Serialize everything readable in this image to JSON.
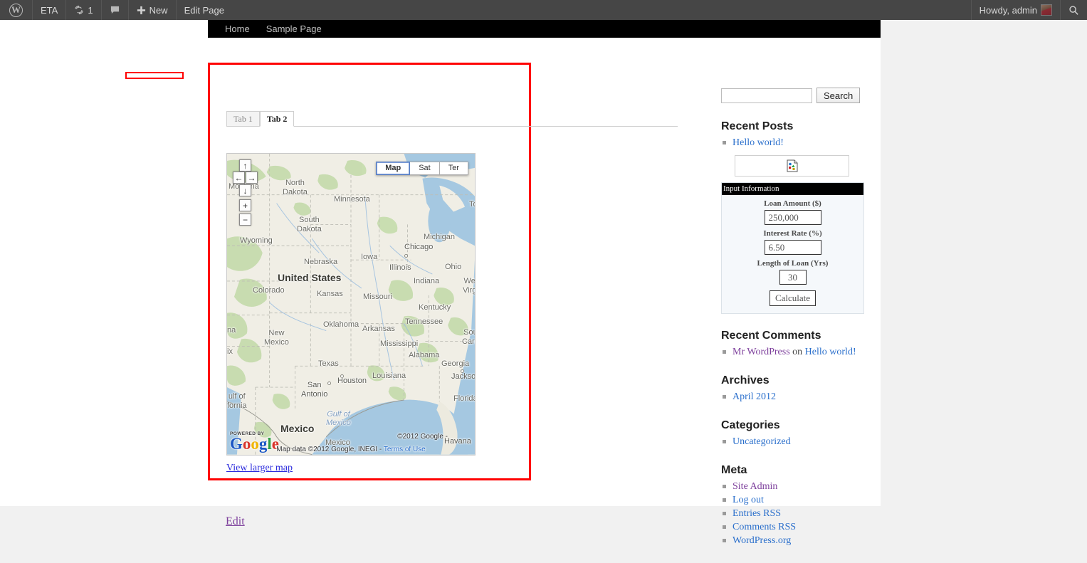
{
  "adminbar": {
    "logo_icon": "wordpress-logo-icon",
    "site_name": "ETA",
    "updates_icon": "sync-icon",
    "updates_count": "1",
    "comments_icon": "comment-bubble-icon",
    "new_icon": "plus-icon",
    "new_label": "New",
    "edit_page_label": "Edit Page",
    "howdy_label": "Howdy, admin",
    "avatar_icon": "avatar",
    "search_icon": "search-icon"
  },
  "nav": {
    "items": [
      {
        "label": "Home"
      },
      {
        "label": "Sample Page"
      }
    ]
  },
  "tabs": [
    {
      "label": "Tab 1",
      "active": false
    },
    {
      "label": "Tab 2",
      "active": true
    }
  ],
  "map": {
    "controls": {
      "pan_up": "↑",
      "pan_left": "←",
      "pan_right": "→",
      "pan_down": "↓",
      "zoom_in": "+",
      "zoom_out": "−"
    },
    "types": [
      {
        "label": "Map",
        "active": true
      },
      {
        "label": "Sat",
        "active": false
      },
      {
        "label": "Ter",
        "active": false
      }
    ],
    "logo": {
      "powered_by": "POWERED BY",
      "g1": "G",
      "o1": "o",
      "o2": "o",
      "g2": "g",
      "l": "l",
      "e": "e"
    },
    "copyright_top": "©2012 Google -",
    "attribution": "Map data ©2012 Google, INEGI - ",
    "terms_label": "Terms of Use",
    "view_larger_label": "View larger map",
    "labels": {
      "country": "United States",
      "country2": "Mexico",
      "states": [
        "North\nDakota",
        "Minnesota",
        "South\nDakota",
        "Wyoming",
        "Nebraska",
        "Iowa",
        "Illinois",
        "Michigan",
        "Ohio",
        "Indiana",
        "Colorado",
        "Kansas",
        "Missouri",
        "Kentucky",
        "West\nVirginia",
        "Oklahoma",
        "Arkansas",
        "Tennessee",
        "Mississippi",
        "Alabama",
        "Georgia",
        "Texas",
        "Louisiana",
        "New\nMexico",
        "Montana",
        "Florida",
        "South\nCarolina"
      ],
      "cities": [
        "Chicago",
        "Houston",
        "San\nAntonio",
        "Jacksonville",
        "Havana"
      ],
      "water": "Gulf of\nMexico"
    }
  },
  "content": {
    "edit_label": "Edit"
  },
  "sidebar": {
    "search": {
      "value": "",
      "placeholder": "",
      "button_label": "Search"
    },
    "recent_posts": {
      "title": "Recent Posts",
      "items": [
        {
          "label": "Hello world!",
          "visited": false
        }
      ]
    },
    "image_widget": {
      "icon": "broken-image-icon"
    },
    "calculator": {
      "header": "Input Information",
      "loan_amount_label": "Loan Amount ($)",
      "loan_amount_value": "250,000",
      "interest_rate_label": "Interest Rate (%)",
      "interest_rate_value": "6.50",
      "length_label": "Length of Loan (Yrs)",
      "length_value": "30",
      "button_label": "Calculate"
    },
    "recent_comments": {
      "title": "Recent Comments",
      "author": "Mr WordPress",
      "on": " on ",
      "post": "Hello world!"
    },
    "archives": {
      "title": "Archives",
      "items": [
        {
          "label": "April 2012"
        }
      ]
    },
    "categories": {
      "title": "Categories",
      "items": [
        {
          "label": "Uncategorized"
        }
      ]
    },
    "meta": {
      "title": "Meta",
      "items": [
        {
          "label": "Site Admin",
          "visited": true
        },
        {
          "label": "Log out",
          "visited": false
        },
        {
          "label": "Entries RSS",
          "visited": false
        },
        {
          "label": "Comments RSS",
          "visited": false
        },
        {
          "label": "WordPress.org",
          "visited": false
        }
      ]
    }
  },
  "colors": {
    "adminbar_bg": "#464646",
    "highlight_red": "#ff0000",
    "link_blue": "#2a6fcc",
    "link_visited": "#7d3f9c",
    "map_land": "#f0eee5",
    "map_water": "#a5c8e1"
  }
}
